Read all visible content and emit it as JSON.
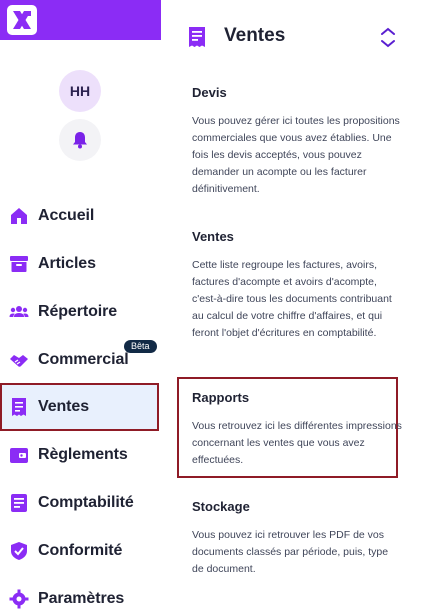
{
  "user": {
    "initials": "HH"
  },
  "nav": {
    "items": [
      {
        "label": "Accueil"
      },
      {
        "label": "Articles"
      },
      {
        "label": "Répertoire"
      },
      {
        "label": "Commercial",
        "badge": "Bêta"
      },
      {
        "label": "Ventes"
      },
      {
        "label": "Règlements"
      },
      {
        "label": "Comptabilité"
      },
      {
        "label": "Conformité"
      },
      {
        "label": "Paramètres"
      }
    ]
  },
  "panel": {
    "title": "Ventes",
    "sections": [
      {
        "title": "Devis",
        "text": "Vous pouvez gérer ici toutes les propositions commerciales que vous avez établies. Une fois les devis acceptés, vous pouvez demander un acompte ou les facturer définitivement."
      },
      {
        "title": "Ventes",
        "text": "Cette liste regroupe les factures, avoirs, factures d'acompte et avoirs d'acompte, c'est-à-dire tous les documents contribuant au calcul de votre chiffre d'affaires, et qui feront l'objet d'écritures en comptabilité."
      },
      {
        "title": "Rapports",
        "text": "Vous retrouvez ici les différentes impressions concernant les ventes que vous avez effectuées."
      },
      {
        "title": "Stockage",
        "text": "Vous pouvez ici retrouver les PDF de vos documents classés par période, puis, type de document."
      }
    ]
  },
  "colors": {
    "brand": "#8b2cf5",
    "active_bg": "#e8f0fd",
    "highlight": "#8f1b26",
    "badge_bg": "#122a46"
  }
}
